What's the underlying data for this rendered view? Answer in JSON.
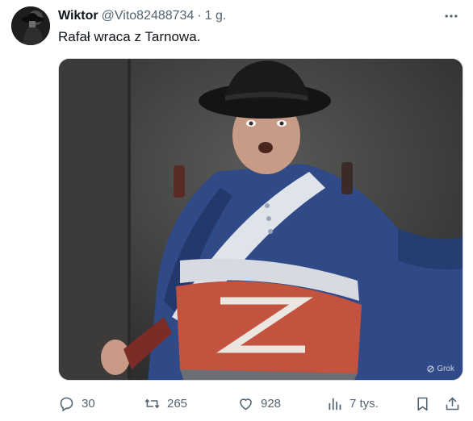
{
  "author": {
    "display_name": "Wiktor",
    "handle": "@Vito82488734",
    "separator": "·",
    "time": "1 g."
  },
  "tweet": {
    "text": "Rafał wraca z Tarnowa."
  },
  "media": {
    "watermark": "Grok"
  },
  "actions": {
    "replies": "30",
    "retweets": "265",
    "likes": "928",
    "views": "7 tys."
  },
  "icons": {
    "more": "more-horizontal-icon",
    "reply": "reply-icon",
    "retweet": "retweet-icon",
    "like": "heart-icon",
    "views": "views-icon",
    "bookmark": "bookmark-icon",
    "share": "share-icon"
  },
  "colors": {
    "text_primary": "#0f1419",
    "text_secondary": "#536471",
    "border": "#cfd9de"
  }
}
